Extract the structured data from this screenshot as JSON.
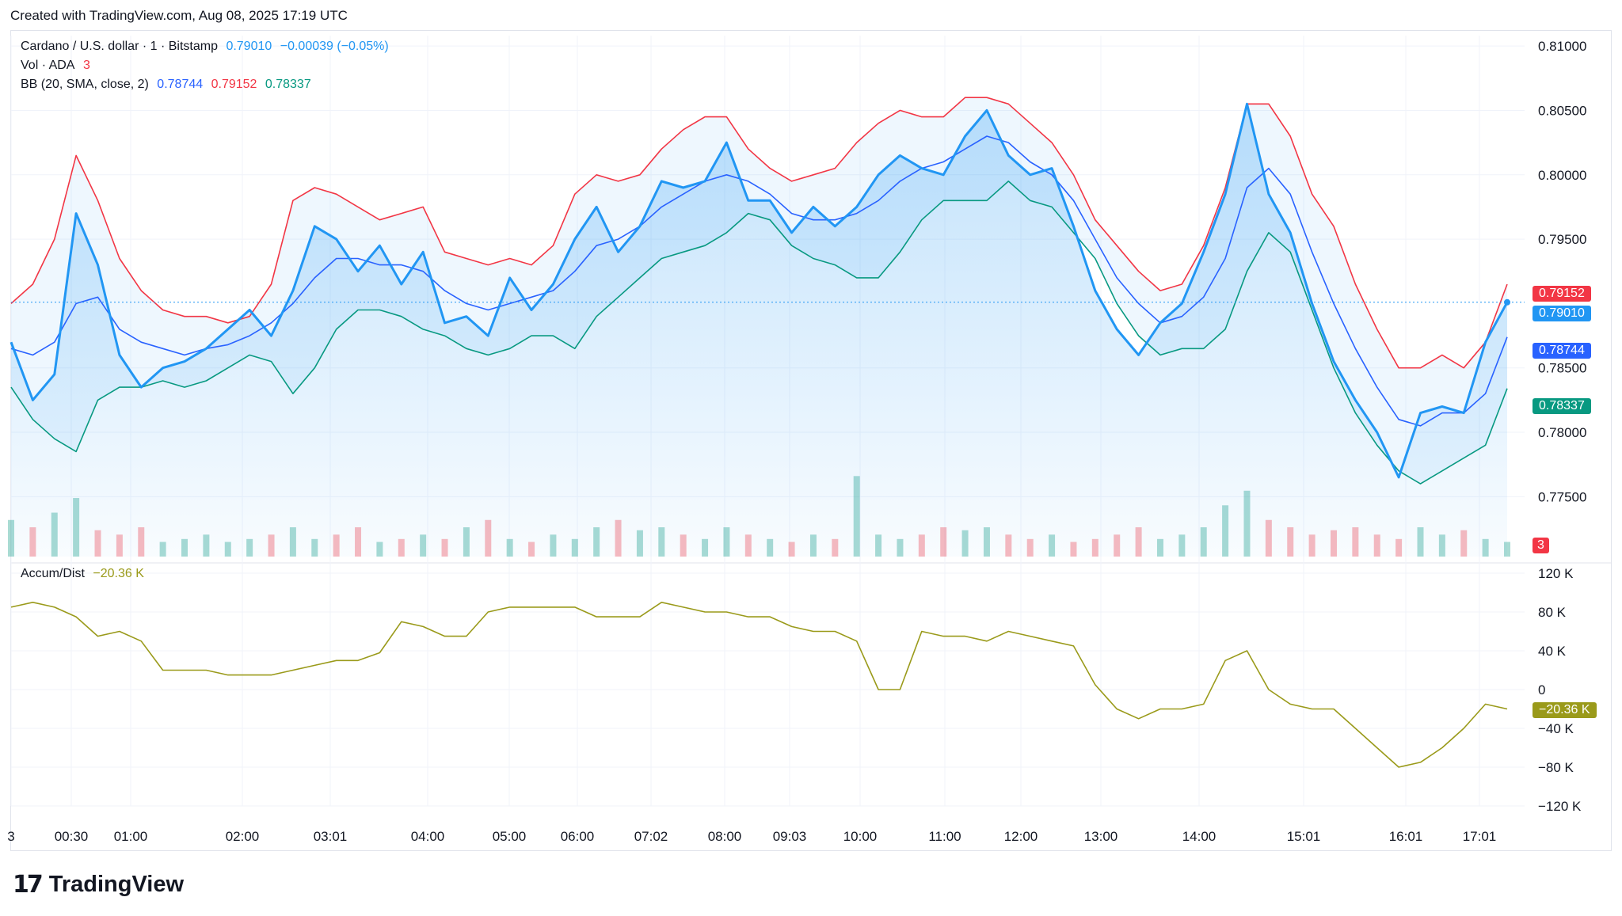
{
  "caption": "Created with TradingView.com, Aug 08, 2025 17:19 UTC",
  "brand": "TradingView",
  "colors": {
    "price": "#2196f3",
    "bb_basis": "#2962ff",
    "bb_upper": "#f23645",
    "bb_lower": "#089981",
    "accum": "#9a9a1a",
    "grid": "#f0f3fa"
  },
  "legend": {
    "symbol": "Cardano / U.S. dollar · 1 · Bitstamp",
    "last": "0.79010",
    "change": "−0.00039 (−0.05%)",
    "vol_label": "Vol · ADA",
    "vol_value": "3",
    "bb_label": "BB (20, SMA, close, 2)",
    "bb_basis": "0.78744",
    "bb_upper": "0.79152",
    "bb_lower": "0.78337",
    "ad_label": "Accum/Dist",
    "ad_value": "−20.36 K"
  },
  "price_tags": {
    "upper": "0.79152",
    "last": "0.79010",
    "basis": "0.78744",
    "lower": "0.78337",
    "volume": "3",
    "ad": "−20.36 K"
  },
  "chart_data": {
    "type": "line",
    "title": "Cardano / U.S. dollar · 1 · Bitstamp",
    "x_tick_labels": [
      "3",
      "00:30",
      "01:00",
      "02:00",
      "03:01",
      "04:00",
      "05:00",
      "06:00",
      "07:02",
      "08:00",
      "09:03",
      "10:00",
      "11:00",
      "12:00",
      "13:00",
      "14:00",
      "15:01",
      "16:01",
      "17:01"
    ],
    "price_axis": {
      "tick_labels": [
        "0.81000",
        "0.80500",
        "0.80000",
        "0.79500",
        "0.78500",
        "0.78000",
        "0.77500"
      ],
      "ylim": [
        0.7725,
        0.8105
      ]
    },
    "ad_axis": {
      "tick_labels": [
        "120 K",
        "80 K",
        "40 K",
        "0",
        "−40 K",
        "−80 K",
        "−120 K"
      ],
      "ylim": [
        -120,
        120
      ]
    },
    "x": [
      "00:00",
      "00:15",
      "00:30",
      "00:45",
      "01:00",
      "01:15",
      "01:30",
      "01:45",
      "02:00",
      "02:15",
      "02:30",
      "02:45",
      "03:00",
      "03:15",
      "03:30",
      "03:45",
      "04:00",
      "04:15",
      "04:30",
      "04:45",
      "05:00",
      "05:15",
      "05:30",
      "05:45",
      "06:00",
      "06:15",
      "06:30",
      "06:45",
      "07:00",
      "07:15",
      "07:30",
      "07:45",
      "08:00",
      "08:15",
      "08:30",
      "08:45",
      "09:00",
      "09:15",
      "09:30",
      "09:45",
      "10:00",
      "10:15",
      "10:30",
      "10:45",
      "11:00",
      "11:15",
      "11:30",
      "11:45",
      "12:00",
      "12:15",
      "12:30",
      "12:45",
      "13:00",
      "13:15",
      "13:30",
      "13:45",
      "14:00",
      "14:15",
      "14:30",
      "14:45",
      "15:00",
      "15:15",
      "15:30",
      "15:45",
      "16:00",
      "16:15",
      "16:30",
      "16:45",
      "17:00",
      "17:15"
    ],
    "series": [
      {
        "name": "Cardano / U.S. dollar",
        "values": [
          0.787,
          0.7825,
          0.7845,
          0.797,
          0.793,
          0.786,
          0.7835,
          0.785,
          0.7855,
          0.7865,
          0.788,
          0.7895,
          0.7875,
          0.791,
          0.796,
          0.795,
          0.7925,
          0.7945,
          0.7915,
          0.794,
          0.7885,
          0.789,
          0.7875,
          0.792,
          0.7895,
          0.7915,
          0.795,
          0.7975,
          0.794,
          0.796,
          0.7995,
          0.799,
          0.7995,
          0.8025,
          0.798,
          0.798,
          0.7955,
          0.7975,
          0.796,
          0.7975,
          0.8,
          0.8015,
          0.8005,
          0.8,
          0.803,
          0.805,
          0.8015,
          0.8,
          0.8005,
          0.796,
          0.791,
          0.788,
          0.786,
          0.7885,
          0.79,
          0.794,
          0.7985,
          0.8055,
          0.7985,
          0.7955,
          0.79,
          0.7855,
          0.7825,
          0.78,
          0.7765,
          0.7815,
          0.782,
          0.7815,
          0.787,
          0.7901
        ]
      },
      {
        "name": "BB basis",
        "values": [
          0.7865,
          0.786,
          0.787,
          0.79,
          0.7905,
          0.788,
          0.787,
          0.7865,
          0.786,
          0.7865,
          0.7868,
          0.7875,
          0.7885,
          0.79,
          0.792,
          0.7935,
          0.7935,
          0.793,
          0.793,
          0.7925,
          0.791,
          0.79,
          0.7895,
          0.79,
          0.7905,
          0.791,
          0.7925,
          0.7945,
          0.795,
          0.796,
          0.7975,
          0.7985,
          0.7995,
          0.8,
          0.7995,
          0.7985,
          0.797,
          0.7965,
          0.7965,
          0.797,
          0.798,
          0.7995,
          0.8005,
          0.801,
          0.802,
          0.803,
          0.8025,
          0.801,
          0.8,
          0.798,
          0.795,
          0.792,
          0.79,
          0.7885,
          0.789,
          0.7905,
          0.7935,
          0.799,
          0.8005,
          0.7985,
          0.794,
          0.79,
          0.7865,
          0.7835,
          0.781,
          0.7805,
          0.7815,
          0.7815,
          0.783,
          0.7874
        ]
      },
      {
        "name": "BB upper",
        "values": [
          0.79,
          0.7915,
          0.795,
          0.8015,
          0.798,
          0.7935,
          0.791,
          0.7895,
          0.789,
          0.789,
          0.7885,
          0.789,
          0.7915,
          0.798,
          0.799,
          0.7985,
          0.7975,
          0.7965,
          0.797,
          0.7975,
          0.794,
          0.7935,
          0.793,
          0.7935,
          0.793,
          0.7945,
          0.7985,
          0.8,
          0.7995,
          0.8,
          0.802,
          0.8035,
          0.8045,
          0.8045,
          0.802,
          0.8005,
          0.7995,
          0.8,
          0.8005,
          0.8025,
          0.804,
          0.805,
          0.8045,
          0.8045,
          0.806,
          0.806,
          0.8055,
          0.804,
          0.8025,
          0.8,
          0.7965,
          0.7945,
          0.7925,
          0.791,
          0.7915,
          0.7945,
          0.799,
          0.8055,
          0.8055,
          0.803,
          0.7985,
          0.796,
          0.7915,
          0.788,
          0.785,
          0.785,
          0.786,
          0.785,
          0.787,
          0.7915
        ]
      },
      {
        "name": "BB lower",
        "values": [
          0.7835,
          0.781,
          0.7795,
          0.7785,
          0.7825,
          0.7835,
          0.7835,
          0.784,
          0.7835,
          0.784,
          0.785,
          0.786,
          0.7855,
          0.783,
          0.785,
          0.788,
          0.7895,
          0.7895,
          0.789,
          0.788,
          0.7875,
          0.7865,
          0.786,
          0.7865,
          0.7875,
          0.7875,
          0.7865,
          0.789,
          0.7905,
          0.792,
          0.7935,
          0.794,
          0.7945,
          0.7955,
          0.797,
          0.7965,
          0.7945,
          0.7935,
          0.793,
          0.792,
          0.792,
          0.794,
          0.7965,
          0.798,
          0.798,
          0.798,
          0.7995,
          0.798,
          0.7975,
          0.7955,
          0.7935,
          0.79,
          0.7875,
          0.786,
          0.7865,
          0.7865,
          0.788,
          0.7925,
          0.7955,
          0.794,
          0.7895,
          0.785,
          0.7815,
          0.779,
          0.777,
          0.776,
          0.777,
          0.778,
          0.779,
          0.7834
        ]
      },
      {
        "name": "Accum/Dist",
        "values": [
          85,
          90,
          85,
          75,
          55,
          60,
          50,
          20,
          20,
          20,
          15,
          15,
          15,
          20,
          25,
          30,
          30,
          38,
          70,
          65,
          55,
          55,
          80,
          85,
          85,
          85,
          85,
          75,
          75,
          75,
          90,
          85,
          80,
          80,
          75,
          75,
          65,
          60,
          60,
          50,
          0,
          0,
          60,
          55,
          55,
          50,
          60,
          55,
          50,
          45,
          5,
          -20,
          -30,
          -20,
          -20,
          -15,
          30,
          40,
          0,
          -15,
          -20,
          -20,
          -40,
          -60,
          -80,
          -75,
          -60,
          -40,
          -15,
          -20
        ]
      },
      {
        "name": "Vol · ADA",
        "values": [
          25,
          20,
          30,
          40,
          18,
          15,
          20,
          10,
          12,
          15,
          10,
          12,
          15,
          20,
          12,
          15,
          20,
          10,
          12,
          15,
          12,
          20,
          25,
          12,
          10,
          15,
          12,
          20,
          25,
          18,
          20,
          15,
          12,
          20,
          15,
          12,
          10,
          15,
          12,
          55,
          15,
          12,
          15,
          20,
          18,
          20,
          15,
          12,
          15,
          10,
          12,
          15,
          20,
          12,
          15,
          20,
          35,
          45,
          25,
          20,
          15,
          18,
          20,
          15,
          12,
          20,
          15,
          18,
          12,
          10
        ]
      }
    ]
  }
}
